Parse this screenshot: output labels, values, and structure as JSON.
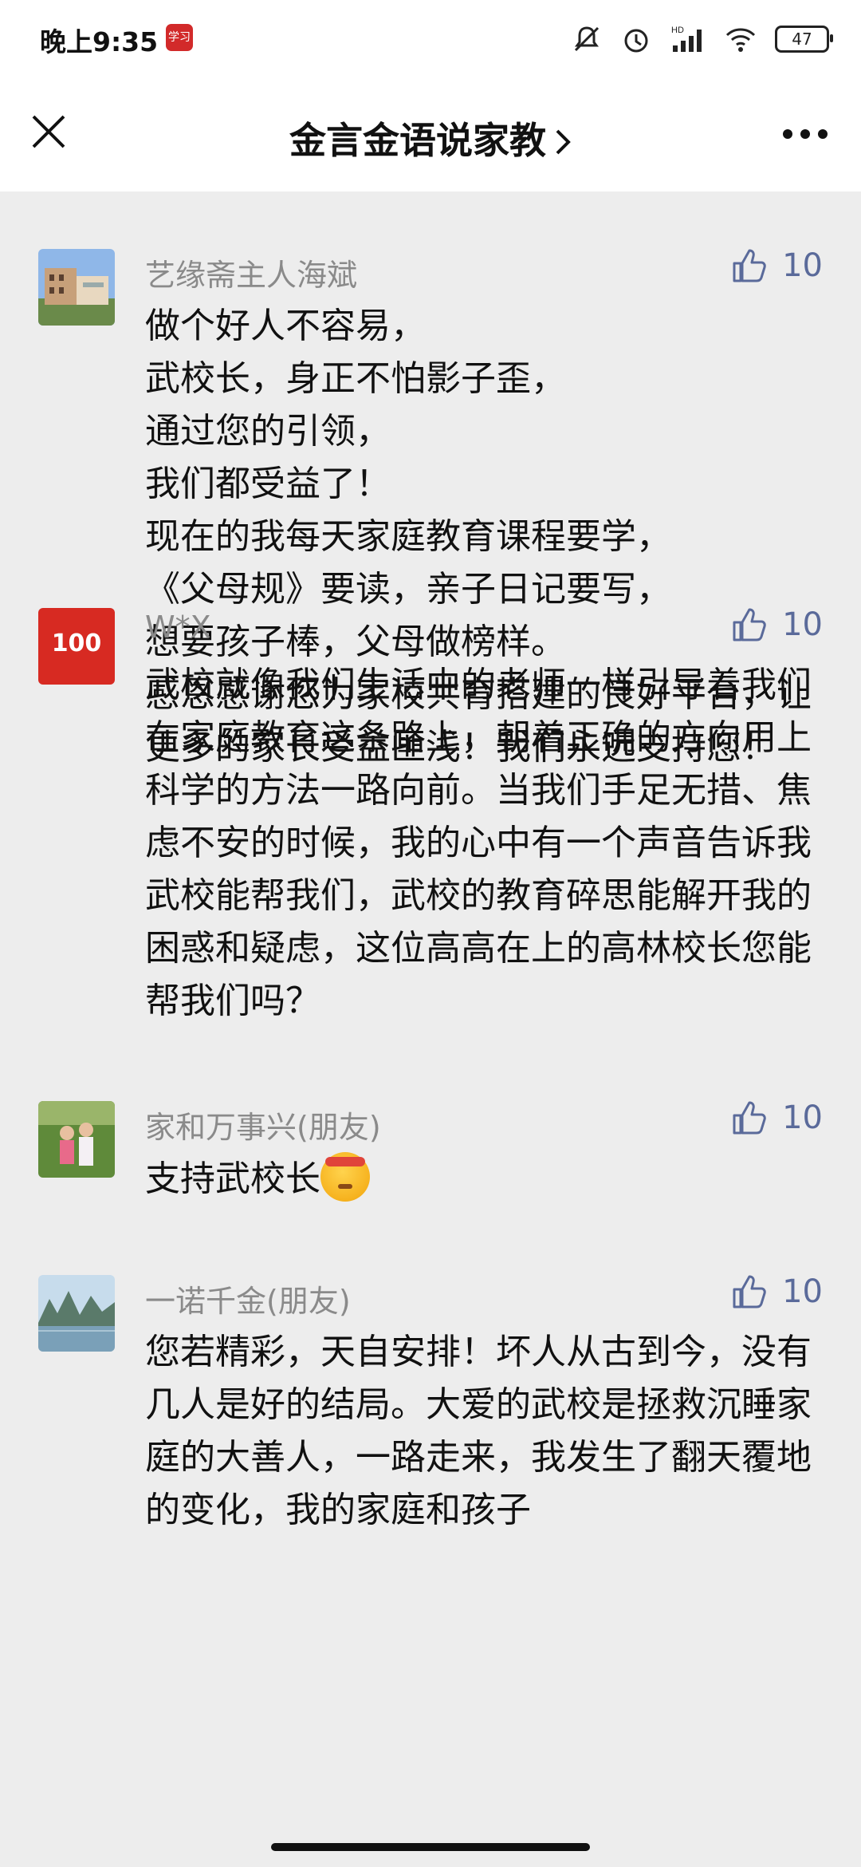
{
  "status_bar": {
    "time": "晚上9:35",
    "app_icon_text": "学习",
    "battery": "47",
    "icons": [
      "mute-icon",
      "alarm-icon",
      "hd-signal-icon",
      "wifi-icon",
      "battery-icon"
    ]
  },
  "nav": {
    "title": "金言金语说家教",
    "icons": [
      "close-icon",
      "chevron-right-icon",
      "more-icon"
    ]
  },
  "colors": {
    "like_blue": "#5a6a9a",
    "nickname_gray": "#8a8a8a",
    "background": "#ededed"
  },
  "comments": [
    {
      "nickname": "艺缘斋主人海斌",
      "likes": "10",
      "text": "做个好人不容易，\n武校长，身正不怕影子歪，\n通过您的引领，\n我们都受益了！\n现在的我每天家庭教育课程要学，\n《父母规》要读，亲子日记要写，\n想要孩子棒，父母做榜样。\n感恩感谢您为家校共育搭建的良好平台，让更多的家长受益匪浅！我们永远支持您！"
    },
    {
      "nickname": "W*X",
      "likes": "10",
      "avatar_text": "100",
      "text": "武校就像我们生活中的老师一样引导着我们在家庭教育这条路上，朝着正确的方向用上科学的方法一路向前。当我们手足无措、焦虑不安的时候，我的心中有一个声音告诉我武校能帮我们，武校的教育碎思能解开我的困惑和疑虑，这位高高在上的高林校长您能帮我们吗？"
    },
    {
      "nickname": "家和万事兴(朋友)",
      "likes": "10",
      "text": "支持武校长"
    },
    {
      "nickname": "一诺千金(朋友)",
      "likes": "10",
      "text": "您若精彩，天自安排！坏人从古到今，没有几人是好的结局。大爱的武校是拯救沉睡家庭的大善人，一路走来，我发生了翻天覆地的变化，我的家庭和孩子"
    }
  ]
}
